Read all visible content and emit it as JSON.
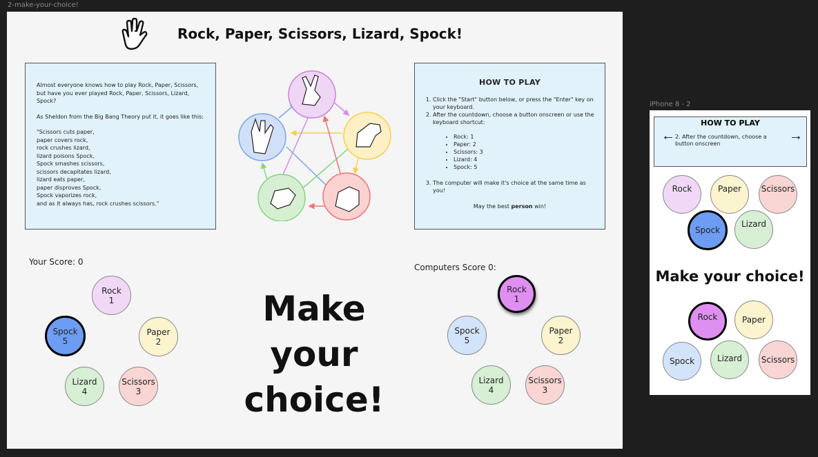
{
  "desktop": {
    "frame_label": "2-make-your-choice!",
    "title": "Rock, Paper, Scissors, Lizard, Spock!",
    "intro": {
      "line1": "Almost everyone knows how to play Rock, Paper, Scissors, but have you ever played Rock, Paper, Scissors, Lizard, Spock?",
      "line2": "As Sheldon from the Big Bang Theory put it, it goes like this:",
      "quote": "\"Scissors cuts paper,\npaper covers rock,\nrock crushes lizard,\nlizard poisons Spock,\nSpock smashes scissors,\nscissors decapitates lizard,\nlizard eats paper,\npaper disproves Spock,\nSpock vaporizes rock,\nand as it always has, rock crushes scissors.\""
    },
    "howto": {
      "heading": "HOW TO PLAY",
      "step1": "Click the \"Start\" button below, or press the \"Enter\" key on your keyboard.",
      "step2": "After the countdown, choose a button onscreen or use the keyboard shortcut:",
      "shortcuts": [
        "Rock: 1",
        "Paper: 2",
        "Scissors: 3",
        "Lizard: 4",
        "Spock: 5"
      ],
      "step3": "The computer will make it's choice at the same time as you!",
      "luck_pre": "May the best ",
      "luck_bold": "person",
      "luck_post": " win!"
    },
    "your_score": "Your Score: 0",
    "computer_score": "Computers Score 0:",
    "headline_line1": "Make your",
    "headline_line2": "choice!",
    "player_choices": {
      "rock": {
        "name": "Rock",
        "key": "1"
      },
      "paper": {
        "name": "Paper",
        "key": "2"
      },
      "scissors": {
        "name": "Scissors",
        "key": "3"
      },
      "lizard": {
        "name": "Lizard",
        "key": "4"
      },
      "spock": {
        "name": "Spock",
        "key": "5"
      }
    },
    "computer_choices": {
      "rock": {
        "name": "Rock",
        "key": "1"
      },
      "paper": {
        "name": "Paper",
        "key": "2"
      },
      "scissors": {
        "name": "Scissors",
        "key": "3"
      },
      "lizard": {
        "name": "Lizard",
        "key": "4"
      },
      "spock": {
        "name": "Spock",
        "key": "5"
      }
    },
    "player_selected": "Spock",
    "computer_selected": "Rock"
  },
  "phone": {
    "frame_label": "iPhone 8 - 2",
    "heading": "HOW TO PLAY",
    "step": "2. After the countdown, choose a button onscreen",
    "prev_arrow": "←",
    "next_arrow": "→",
    "player_choices": [
      "Rock",
      "Paper",
      "Scissors",
      "Spock",
      "Lizard"
    ],
    "headline": "Make your choice!",
    "computer_choices": [
      "Rock",
      "Paper",
      "Spock",
      "Lizard",
      "Scissors"
    ],
    "player_selected": "Spock",
    "computer_selected": "Rock"
  },
  "colors": {
    "rock": "#f0d8f6",
    "paper": "#fcf3cf",
    "scissors": "#f9d5d3",
    "lizard": "#d7efd4",
    "spock": "#d3e3fa",
    "panel": "#e1f2fb",
    "selected_player": "#6d9cf3",
    "selected_computer": "#de8ff0"
  },
  "icons": {
    "logo": "vulcan-salute-hand-icon",
    "diagram": [
      "scissors-hand-icon",
      "paper-hand-icon",
      "rock-fist-icon",
      "lizard-hand-icon",
      "spock-hand-icon"
    ]
  }
}
